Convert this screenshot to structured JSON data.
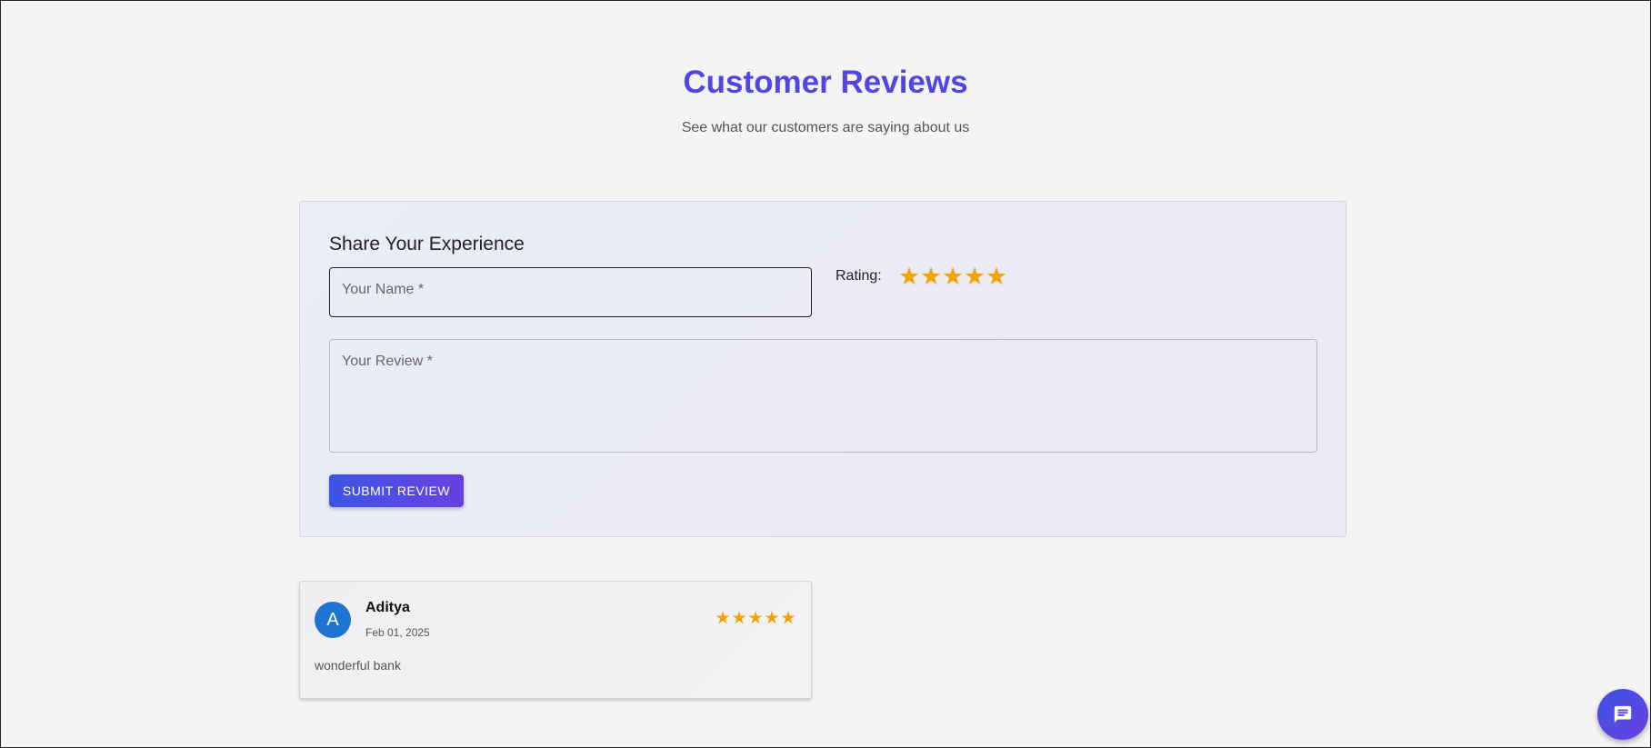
{
  "header": {
    "title": "Customer Reviews",
    "subtitle": "See what our customers are saying about us"
  },
  "form": {
    "title": "Share Your Experience",
    "name_placeholder": "Your Name *",
    "rating_label": "Rating:",
    "rating_value": 5,
    "rating_max": 5,
    "review_placeholder": "Your Review *",
    "submit_label": "SUBMIT REVIEW"
  },
  "reviews": [
    {
      "avatar_letter": "A",
      "name": "Aditya",
      "date": "Feb 01, 2025",
      "rating": 5,
      "text": "wonderful bank"
    }
  ],
  "icons": {
    "star": "star-icon",
    "chat": "chat-icon"
  },
  "colors": {
    "accent": "#4f46e5",
    "star": "#f5a300",
    "avatar": "#1e74d0"
  }
}
